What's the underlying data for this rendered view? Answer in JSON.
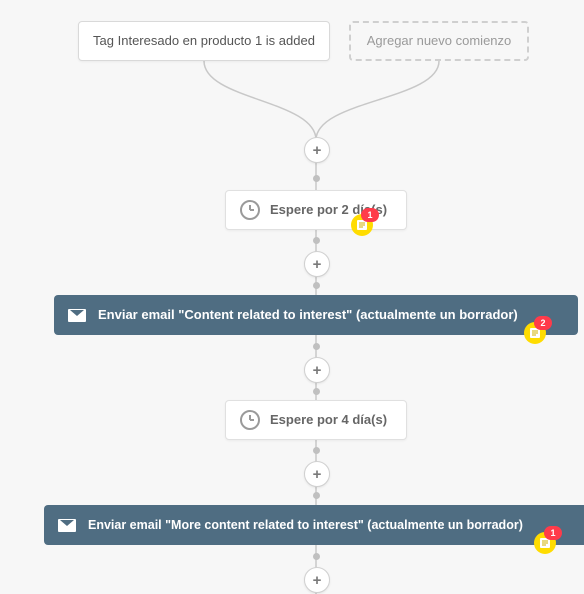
{
  "trigger": {
    "label": "Tag Interesado en producto 1 is added"
  },
  "ghost": {
    "label": "Agregar nuevo comienzo"
  },
  "wait1": {
    "label": "Espere por 2 día(s)",
    "note_count": "1"
  },
  "action1": {
    "label": "Enviar email \"Content related to interest\" (actualmente un borrador)",
    "note_count": "2"
  },
  "wait2": {
    "label": "Espere por 4 día(s)"
  },
  "action2": {
    "label": "Enviar email \"More content related to interest\" (actualmente un borrador)",
    "note_count": "1"
  },
  "plus_glyph": "+"
}
